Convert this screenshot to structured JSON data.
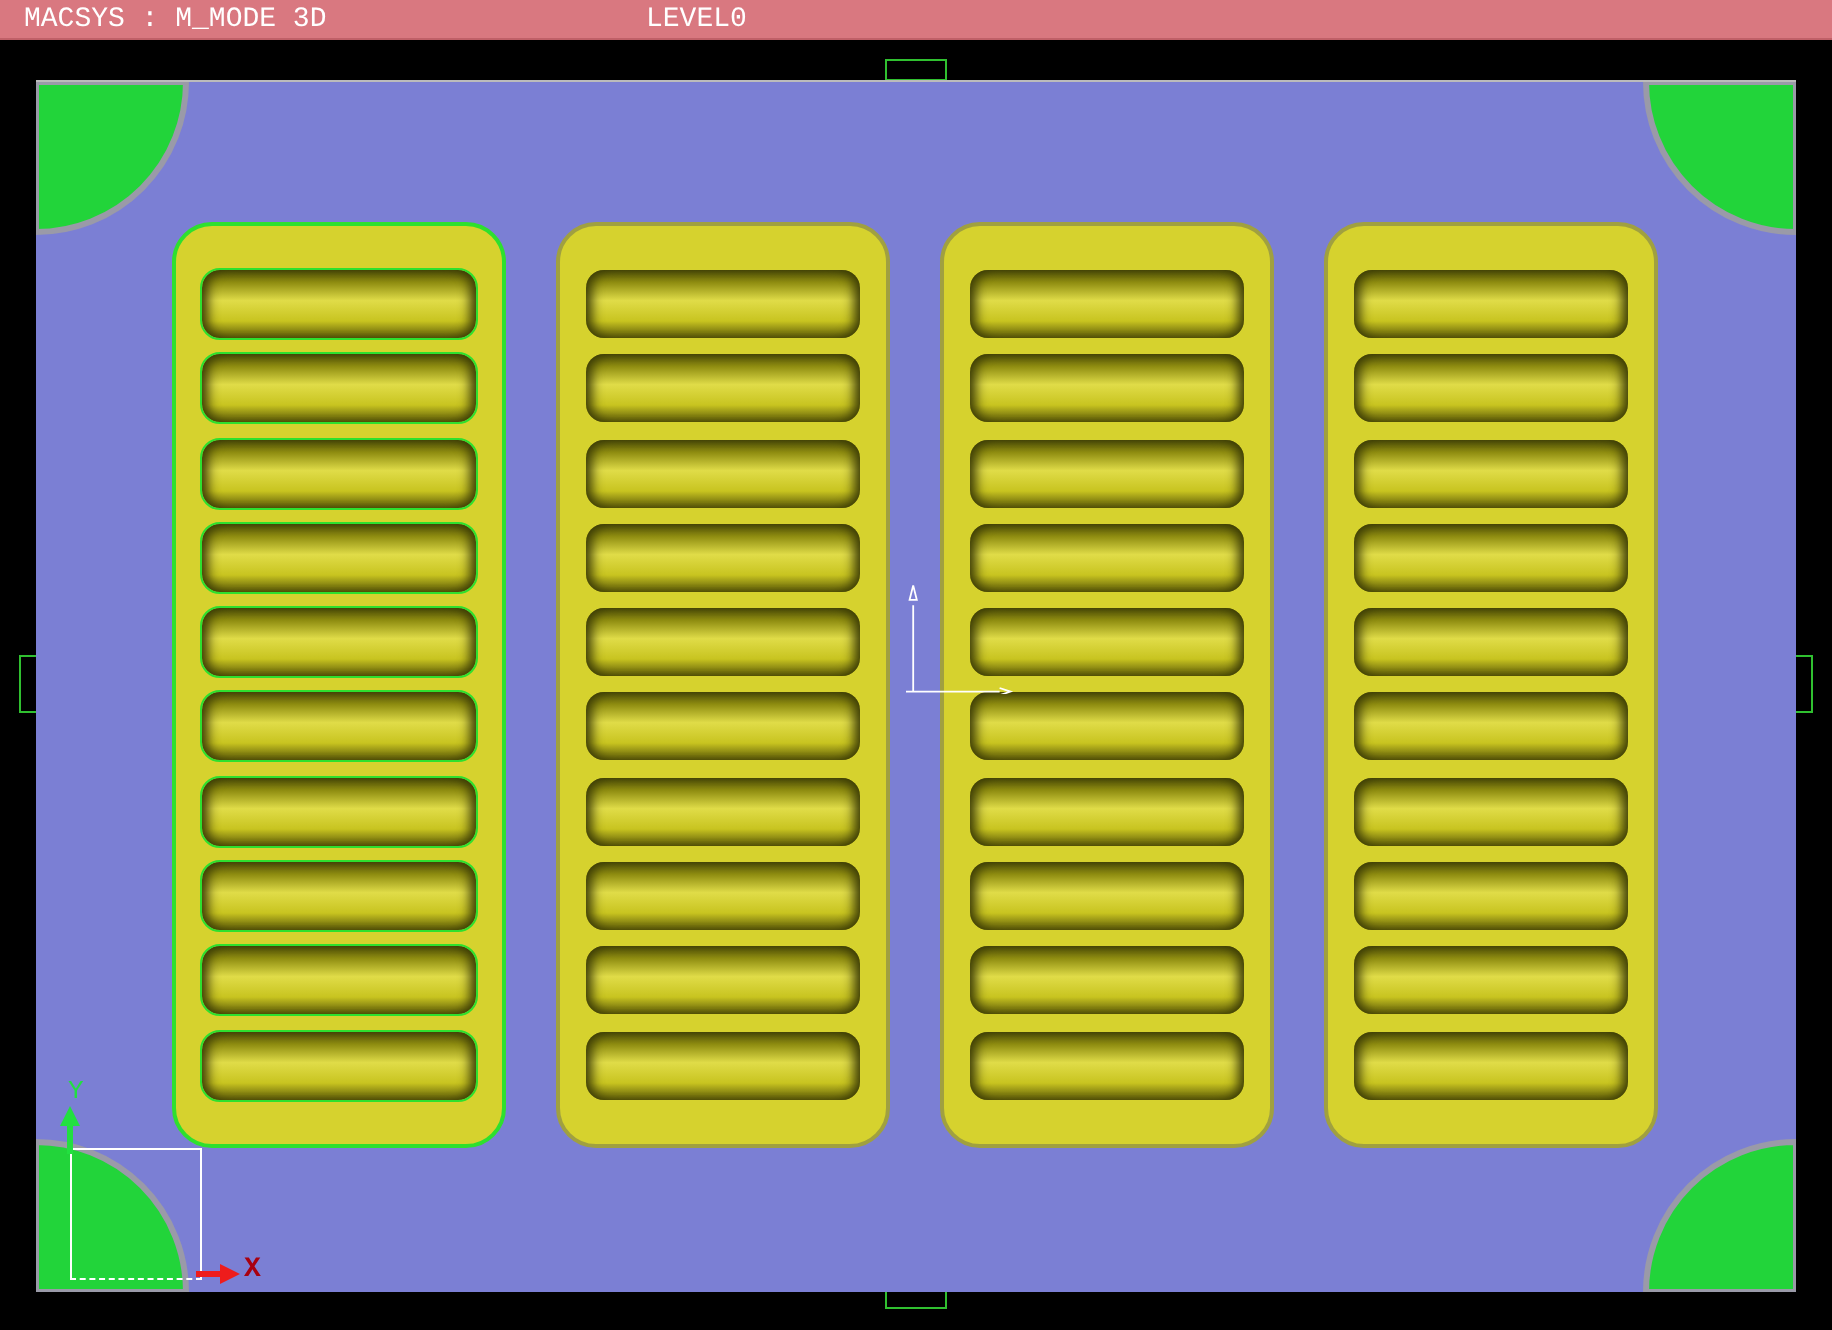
{
  "title_bar": {
    "mode": "MACSYS : M_MODE 3D",
    "level": "LEVEL0"
  },
  "panels": [
    {
      "selected": true
    },
    {
      "selected": false
    },
    {
      "selected": false
    },
    {
      "selected": false
    }
  ],
  "axis": {
    "x_label": "X",
    "y_label": "Y"
  }
}
